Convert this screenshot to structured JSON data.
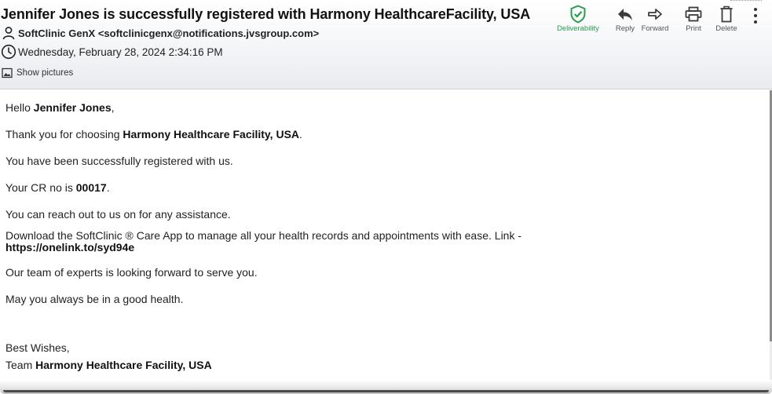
{
  "email": {
    "subject": "Jennifer Jones is successfully registered with Harmony HealthcareFacility, USA",
    "from": "SoftClinic GenX <softclinicgenx@notifications.jvsgroup.com>",
    "date": "Wednesday, February 28, 2024 2:34:16 PM",
    "show_pictures": "Show pictures"
  },
  "toolbar": {
    "deliverability": "Deliverability",
    "reply": "Reply",
    "forward": "Forward",
    "print": "Print",
    "delete": "Delete"
  },
  "body": {
    "greeting_prefix": "Hello ",
    "recipient_name": "Jennifer Jones",
    "greeting_suffix": ",",
    "thanks_prefix": "Thank you for choosing ",
    "facility_name": "Harmony Healthcare Facility, USA",
    "thanks_suffix": ".",
    "registered": "You have been successfully registered with us.",
    "cr_prefix": "Your CR no is ",
    "cr_number": "00017",
    "cr_suffix": ".",
    "reach_out": "You can reach out to us on for any assistance.",
    "download_text": "Download the SoftClinic ® Care App to manage all your health records and appointments with ease. Link -",
    "download_link": "https://onelink.to/syd94e",
    "team_experts": "Our team of experts is looking forward to serve you.",
    "good_health": "May you always be in a good health.",
    "closing": "Best Wishes,",
    "signature_prefix": "Team ",
    "signature_name": "Harmony Healthcare Facility, USA"
  },
  "colors": {
    "deliverability_green": "#2a9d4a",
    "icon_dark": "#333333"
  },
  "icons": {
    "sender": "person-icon",
    "date": "clock-icon",
    "pictures": "image-icon",
    "deliverability": "shield-check-icon",
    "reply": "reply-arrow-icon",
    "forward": "forward-arrow-icon",
    "print": "printer-icon",
    "delete": "trash-icon",
    "more": "kebab-menu-icon"
  }
}
